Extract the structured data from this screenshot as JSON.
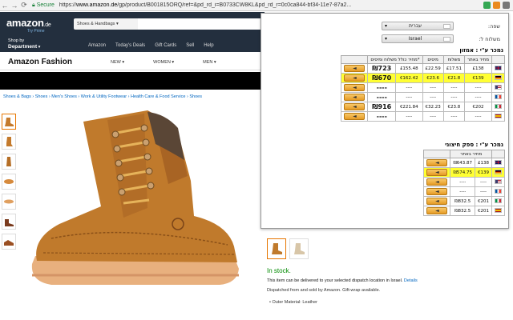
{
  "browser": {
    "secure_label": "Secure",
    "url_prefix": "https://",
    "url_domain": "www.amazon.de",
    "url_rest": "/gp/product/B001815ORQ/ref=&pd_rd_i=B0733CW8KL&pd_rd_r=0c0ca844-bf34-11e7-87a2..."
  },
  "amazon": {
    "logo": "amazon",
    "logo_tld": ".de",
    "prime": "Try Prime",
    "search_category": "Shoes & Handbags",
    "shop_by": "Shop by",
    "department": "Department",
    "nav": [
      "Amazon",
      "Today's Deals",
      "Gift Cards",
      "Sell",
      "Help"
    ],
    "fashion_title": "Amazon Fashion",
    "fashion_nav": [
      "NEW",
      "WOMEN",
      "MEN"
    ],
    "breadcrumb": "Shoes & Bags › Shoes › Men's Shoes › Work & Utility Footwear › Health Care & Food Service › Shoes",
    "stock": "In stock.",
    "delivery_text": "This item can be delivered to your selected dispatch location in Israel.",
    "delivery_link": "Details",
    "dispatched": "Dispatched from and sold by Amazon. Gift-wrap available.",
    "material": "• Outer Material: Leather"
  },
  "popup": {
    "language_label": "שפה:",
    "language_value": "עברית",
    "ship_label": "משלוח ל:",
    "ship_value": "Israel",
    "section1_title": "נמכר ע\"י : אמזון",
    "section1_headers": [
      "",
      "מחיר באתר",
      "משלוח",
      "מיסים",
      "*מחיר כולל משלוח ומיסים",
      ""
    ],
    "section1_rows": [
      {
        "flag": "uk",
        "price": "£138",
        "ship": "£17.51",
        "tax": "£22.59",
        "total_sub": "£155.48",
        "total": "723",
        "currency": "₪",
        "highlight": false
      },
      {
        "flag": "de",
        "price": "€139",
        "ship": "€21.8",
        "tax": "€23.6",
        "total_sub": "€162.42",
        "total": "670",
        "currency": "₪",
        "highlight": true
      },
      {
        "flag": "us",
        "price": "----",
        "ship": "----",
        "tax": "----",
        "total_sub": "----",
        "total": "----",
        "currency": "",
        "highlight": false
      },
      {
        "flag": "fr",
        "price": "----",
        "ship": "----",
        "tax": "----",
        "total_sub": "----",
        "total": "----",
        "currency": "",
        "highlight": false
      },
      {
        "flag": "it",
        "price": "€202",
        "ship": "€23.8",
        "tax": "€32.23",
        "total_sub": "€221.84",
        "total": "916",
        "currency": "₪",
        "highlight": false
      },
      {
        "flag": "es",
        "price": "----",
        "ship": "----",
        "tax": "----",
        "total_sub": "----",
        "total": "----",
        "currency": "",
        "highlight": false
      }
    ],
    "section2_title": "נמכר ע\"י : ספק חיצוני",
    "section2_header": "מחיר באתר",
    "section2_rows": [
      {
        "flag": "uk",
        "price": "£138",
        "converted": "₪643.87",
        "highlight": false
      },
      {
        "flag": "de",
        "price": "€139",
        "converted": "₪574.75",
        "highlight": true
      },
      {
        "flag": "us",
        "price": "----",
        "converted": "----",
        "highlight": false
      },
      {
        "flag": "fr",
        "price": "----",
        "converted": "----",
        "highlight": false
      },
      {
        "flag": "it",
        "price": "€201",
        "converted": "₪832.5",
        "highlight": false
      },
      {
        "flag": "es",
        "price": "€201",
        "converted": "₪832.5",
        "highlight": false
      }
    ],
    "button_glyph": "◄"
  },
  "colors": {
    "amazon_dark": "#232f3e",
    "highlight": "#ffff33",
    "button": "#e59a24",
    "stock_green": "#008a00"
  }
}
